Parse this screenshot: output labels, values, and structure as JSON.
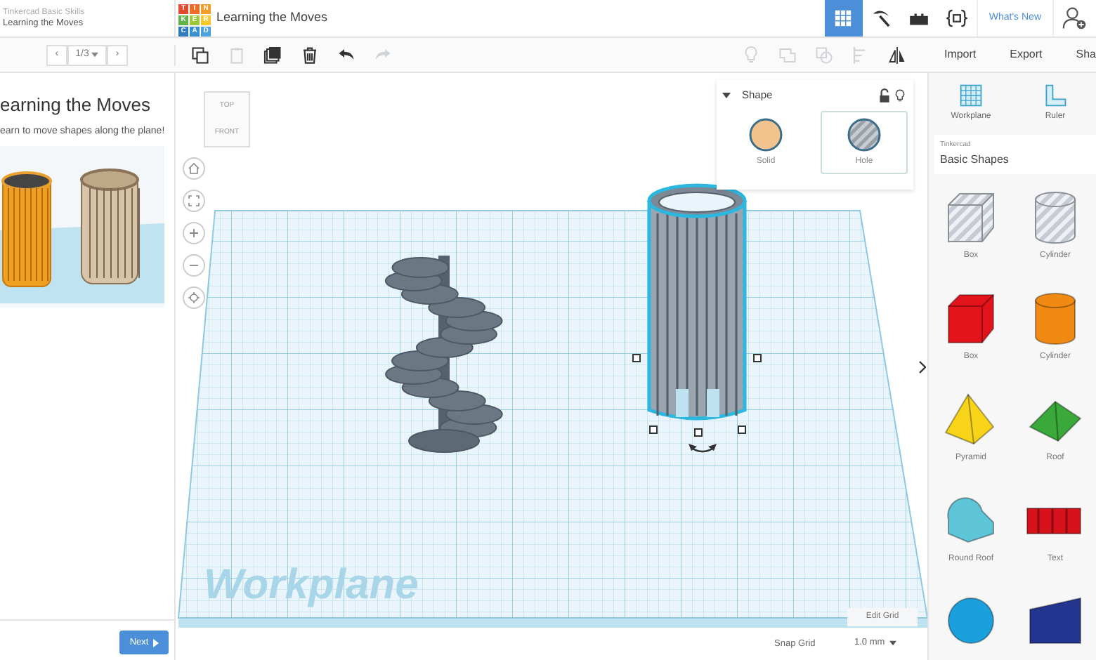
{
  "header": {
    "course": "Tinkercad Basic Skills",
    "lesson": "Learning the Moves",
    "logo": [
      {
        "letter": "T",
        "color": "#e2492f"
      },
      {
        "letter": "I",
        "color": "#ef6c2a"
      },
      {
        "letter": "N",
        "color": "#f39c27"
      },
      {
        "letter": "K",
        "color": "#5eb34c"
      },
      {
        "letter": "E",
        "color": "#9cc83b"
      },
      {
        "letter": "R",
        "color": "#f7c72e"
      },
      {
        "letter": "C",
        "color": "#2e7ac0"
      },
      {
        "letter": "A",
        "color": "#3a8fd0"
      },
      {
        "letter": "D",
        "color": "#4aa3df"
      }
    ],
    "title": "Learning the Moves",
    "views": [
      {
        "kind": "grid",
        "selected": true
      },
      {
        "kind": "pickaxe",
        "selected": false
      },
      {
        "kind": "bricks",
        "selected": false
      },
      {
        "kind": "code",
        "selected": false
      }
    ],
    "whats_new": "What's New"
  },
  "toolbar": {
    "pager": {
      "prev": "‹",
      "page": "1/3",
      "next": "›"
    },
    "edit_tools": [
      {
        "kind": "copy",
        "disabled": false
      },
      {
        "kind": "paste",
        "disabled": true
      },
      {
        "kind": "duplicate",
        "disabled": false
      },
      {
        "kind": "delete",
        "disabled": false
      },
      {
        "kind": "undo",
        "disabled": false
      },
      {
        "kind": "redo",
        "disabled": true
      }
    ],
    "shape_tools": [
      {
        "kind": "bulb",
        "disabled": true
      },
      {
        "kind": "group",
        "disabled": true
      },
      {
        "kind": "ungroup",
        "disabled": true
      },
      {
        "kind": "align",
        "disabled": true
      },
      {
        "kind": "mirror",
        "disabled": false
      }
    ],
    "actions": [
      "Import",
      "Export",
      "Sha"
    ]
  },
  "lesson_panel": {
    "heading": "earning the Moves",
    "body": "earn to move shapes along the plane!",
    "next": "Next"
  },
  "canvas": {
    "view_cube": {
      "top": "TOP",
      "front": "FRONT"
    },
    "nav": [
      {
        "kind": "home"
      },
      {
        "kind": "fit"
      },
      {
        "kind": "zoom_in"
      },
      {
        "kind": "zoom_out"
      },
      {
        "kind": "perspective"
      }
    ],
    "objects": [
      {
        "kind": "staircase",
        "selected": false
      },
      {
        "kind": "cage",
        "selected": true
      }
    ],
    "workplane_label": "Workplane",
    "edit_grid": "Edit Grid",
    "snap_label": "Snap Grid",
    "snap_value": "1.0 mm"
  },
  "inspector": {
    "title": "Shape",
    "locked": false,
    "options": [
      {
        "kind": "solid",
        "label": "Solid",
        "selected": false
      },
      {
        "kind": "hole",
        "label": "Hole",
        "selected": true
      }
    ]
  },
  "library": {
    "tools": [
      {
        "kind": "workplane",
        "label": "Workplane"
      },
      {
        "kind": "ruler",
        "label": "Ruler"
      }
    ],
    "source": "Tinkercad",
    "name": "Basic Shapes",
    "shapes": [
      {
        "kind": "box",
        "label": "Box",
        "hole": true,
        "color": "#c5cad3"
      },
      {
        "kind": "cylinder",
        "label": "Cylinder",
        "hole": true,
        "color": "#c5cad3"
      },
      {
        "kind": "box",
        "label": "Box",
        "hole": false,
        "color": "#e3131b"
      },
      {
        "kind": "cylinder",
        "label": "Cylinder",
        "hole": false,
        "color": "#f08a12"
      },
      {
        "kind": "pyramid",
        "label": "Pyramid",
        "hole": false,
        "color": "#f7d417"
      },
      {
        "kind": "roof",
        "label": "Roof",
        "hole": false,
        "color": "#3aa83a"
      },
      {
        "kind": "round_roof",
        "label": "Round Roof",
        "hole": false,
        "color": "#5ec5d8"
      },
      {
        "kind": "text",
        "label": "Text",
        "hole": false,
        "color": "#d8121b"
      },
      {
        "kind": "sphere",
        "hole": false,
        "color": "#1aa0dc"
      },
      {
        "kind": "wedge",
        "hole": false,
        "color": "#23358f"
      }
    ]
  }
}
